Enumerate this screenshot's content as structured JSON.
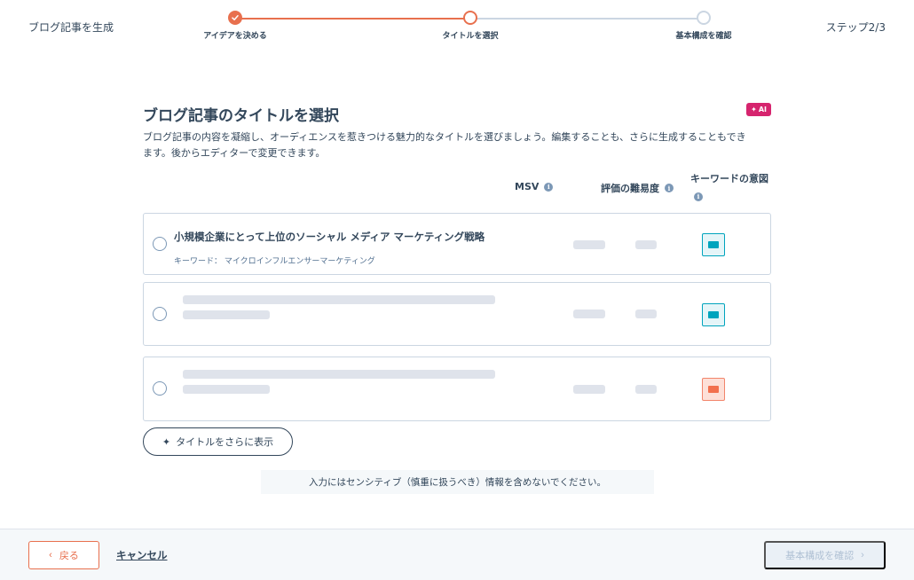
{
  "header": {
    "app_title": "ブログ記事を生成",
    "step_count": "ステップ2/3",
    "steps": [
      {
        "label": "アイデアを決める",
        "state": "done"
      },
      {
        "label": "タイトルを選択",
        "state": "current"
      },
      {
        "label": "基本構成を確認",
        "state": "todo"
      }
    ]
  },
  "main": {
    "title": "ブログ記事のタイトルを選択",
    "ai_badge": "AI",
    "description": "ブログ記事の内容を凝縮し、オーディエンスを惹きつける魅力的なタイトルを選びましょう。編集することも、さらに生成することもできます。後からエディターで変更できます。",
    "columns": {
      "msv": "MSV",
      "difficulty": "評価の難易度",
      "intent": "キーワードの意図"
    },
    "rows": [
      {
        "title": "小規模企業にとって上位のソーシャル メディア マーケティング戦略",
        "keyword": "キーワード： マイクロインフルエンサーマーケティング",
        "intent_color": "teal",
        "loading": false
      },
      {
        "title": "",
        "keyword": "",
        "intent_color": "teal",
        "loading": true
      },
      {
        "title": "",
        "keyword": "",
        "intent_color": "coral",
        "loading": true
      }
    ],
    "more_button": "タイトルをさらに表示",
    "notice": "入力にはセンシティブ（慎重に扱うべき）情報を含めないでください。"
  },
  "footer": {
    "back_label": "戻る",
    "cancel_label": "キャンセル",
    "next_label": "基本構成を確認"
  },
  "colors": {
    "accent": "#e8704e",
    "text": "#33475b",
    "ai_badge": "#d6246e",
    "intent_teal": "#00a4bd",
    "intent_coral": "#f2704e"
  }
}
